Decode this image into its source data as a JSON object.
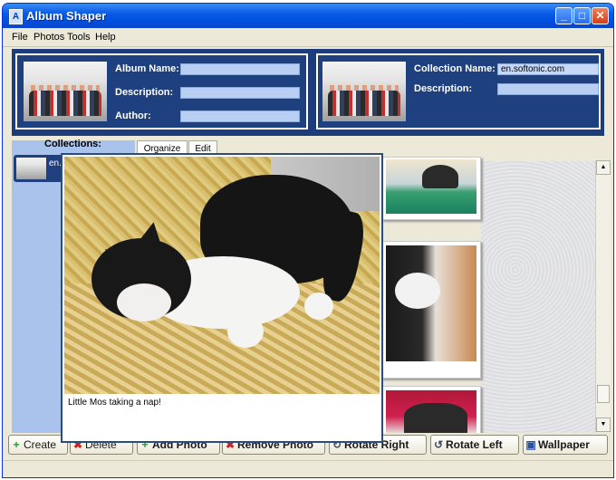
{
  "window": {
    "title": "Album Shaper"
  },
  "menu": [
    "File",
    "Photos",
    "Tools",
    "Help"
  ],
  "album": {
    "name_label": "Album Name:",
    "description_label": "Description:",
    "author_label": "Author:",
    "name_value": "",
    "description_value": "",
    "author_value": ""
  },
  "collection": {
    "name_label": "Collection Name:",
    "name_value": "en.softonic.com",
    "description_label": "Description:",
    "description_value": ""
  },
  "collections": {
    "label": "Collections:",
    "items": [
      {
        "label": "en."
      }
    ]
  },
  "tabs": [
    "Organize",
    "Edit"
  ],
  "preview": {
    "caption": "Little Mos taking a nap!"
  },
  "buttons": {
    "create": "Create",
    "delete": "Delete",
    "add_photo": "Add Photo",
    "remove_photo": "Remove Photo",
    "rotate_right": "Rotate Right",
    "rotate_left": "Rotate Left",
    "wallpaper": "Wallpaper"
  },
  "colors": {
    "header_panel": "#1d3c7c",
    "collections_pane": "#a9c3ec",
    "field": "#b8cff3",
    "titlebar": "#0a5ce8"
  }
}
